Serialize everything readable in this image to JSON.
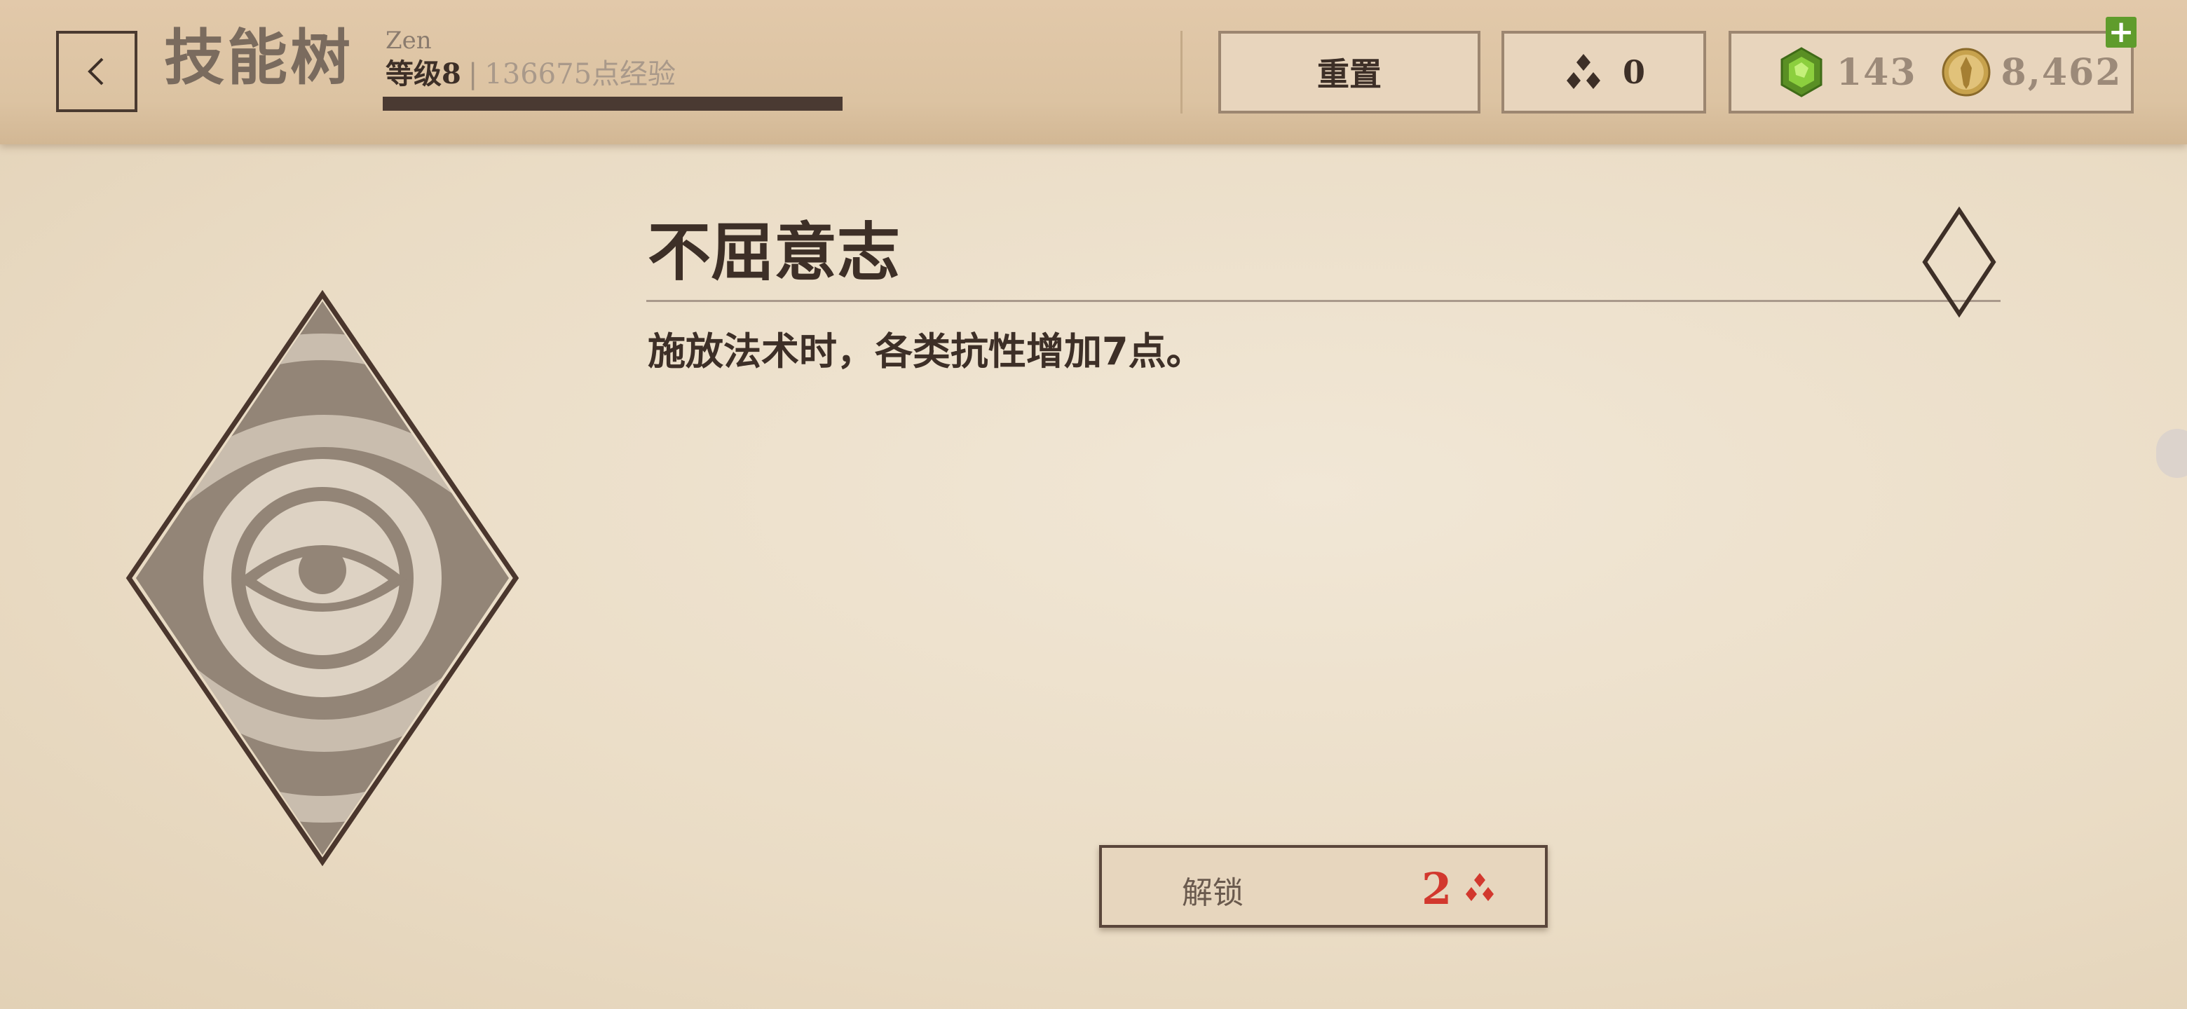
{
  "header": {
    "title": "技能树",
    "player_name": "Zen",
    "level_label": "等级",
    "level": "8",
    "separator": "|",
    "xp_text": "136675点经验",
    "xp_progress": 1.0,
    "reset_label": "重置",
    "skill_points": "0",
    "gems": "143",
    "gold": "8,462",
    "add_label": "+"
  },
  "skill": {
    "name": "不屈意志",
    "description": "施放法术时，各类抗性增加7点。",
    "unlock_label": "解锁",
    "unlock_cost": "2"
  },
  "colors": {
    "paper": "#ece0cb",
    "ink": "#3d2f27",
    "cost_red": "#d2382e",
    "gem_green": "#6aa32e",
    "plus_green": "#5f9c2c"
  },
  "icons": [
    "back-arrow-icon",
    "skill-point-icon",
    "gem-icon",
    "gold-coin-icon",
    "plus-icon",
    "eye-emblem-icon",
    "rank-diamond-icon"
  ]
}
